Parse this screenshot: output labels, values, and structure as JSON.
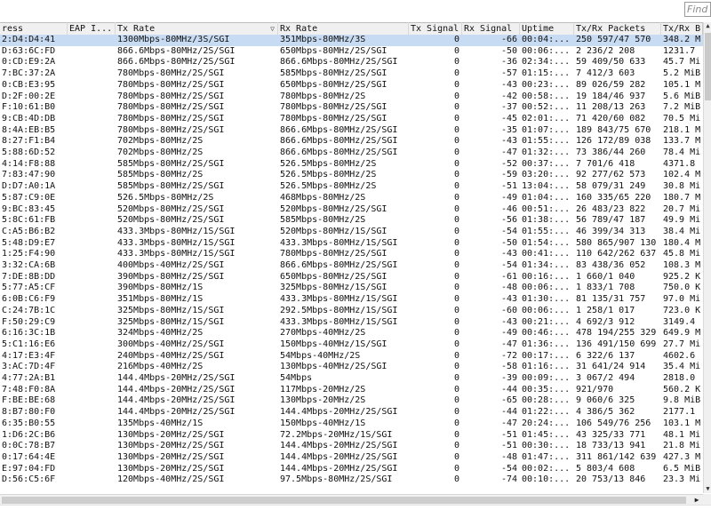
{
  "search": {
    "placeholder": "Find"
  },
  "columns": [
    {
      "key": "mac",
      "label": "ress"
    },
    {
      "key": "eap",
      "label": "EAP I..."
    },
    {
      "key": "tx_rate",
      "label": "Tx Rate"
    },
    {
      "key": "rx_rate",
      "label": "Rx Rate"
    },
    {
      "key": "tx_signal",
      "label": "Tx Signal"
    },
    {
      "key": "rx_signal",
      "label": "Rx Signal"
    },
    {
      "key": "uptime",
      "label": "Uptime"
    },
    {
      "key": "packets",
      "label": "Tx/Rx Packets"
    },
    {
      "key": "bytes",
      "label": "Tx/Rx B"
    }
  ],
  "sorted_column_mark": "▽",
  "selected_row": 0,
  "rows": [
    [
      "2:D4:D4:41",
      "",
      "1300Mbps-80MHz/3S/SGI",
      "351Mbps-80MHz/3S",
      "0",
      "-66",
      "00:04:...",
      "250 597/47 570",
      "348.2 M"
    ],
    [
      "D:63:6C:FD",
      "",
      "866.6Mbps-80MHz/2S/SGI",
      "650Mbps-80MHz/2S/SGI",
      "0",
      "-50",
      "00:06:...",
      "2 236/2 208",
      "1231.7"
    ],
    [
      "0:CD:E9:2A",
      "",
      "866.6Mbps-80MHz/2S/SGI",
      "866.6Mbps-80MHz/2S/SGI",
      "0",
      "-36",
      "02:34:...",
      "59 409/50 633",
      "45.7 Mi"
    ],
    [
      "7:BC:37:2A",
      "",
      "780Mbps-80MHz/2S/SGI",
      "585Mbps-80MHz/2S/SGI",
      "0",
      "-57",
      "01:15:...",
      "7 412/3 603",
      "5.2 MiB"
    ],
    [
      "0:CB:E3:95",
      "",
      "780Mbps-80MHz/2S/SGI",
      "650Mbps-80MHz/2S/SGI",
      "0",
      "-43",
      "00:23:...",
      "89 026/59 282",
      "105.1 M"
    ],
    [
      "D:2F:00:2E",
      "",
      "780Mbps-80MHz/2S/SGI",
      "780Mbps-80MHz/2S",
      "0",
      "-42",
      "00:58:...",
      "19 184/46 937",
      "5.6 MiB"
    ],
    [
      "F:10:61:B0",
      "",
      "780Mbps-80MHz/2S/SGI",
      "780Mbps-80MHz/2S/SGI",
      "0",
      "-37",
      "00:52:...",
      "11 208/13 263",
      "7.2 MiB"
    ],
    [
      "9:CB:4D:DB",
      "",
      "780Mbps-80MHz/2S/SGI",
      "780Mbps-80MHz/2S/SGI",
      "0",
      "-45",
      "02:01:...",
      "71 420/60 082",
      "70.5 Mi"
    ],
    [
      "8:4A:EB:B5",
      "",
      "780Mbps-80MHz/2S/SGI",
      "866.6Mbps-80MHz/2S/SGI",
      "0",
      "-35",
      "01:07:...",
      "189 843/75 670",
      "218.1 M"
    ],
    [
      "8:27:F1:B4",
      "",
      "702Mbps-80MHz/2S",
      "866.6Mbps-80MHz/2S/SGI",
      "0",
      "-43",
      "01:55:...",
      "126 172/89 038",
      "133.7 M"
    ],
    [
      "5:88:6D:52",
      "",
      "702Mbps-80MHz/2S",
      "866.6Mbps-80MHz/2S/SGI",
      "0",
      "-47",
      "01:32:...",
      "73 386/44 260",
      "78.4 Mi"
    ],
    [
      "4:14:F8:88",
      "",
      "585Mbps-80MHz/2S/SGI",
      "526.5Mbps-80MHz/2S",
      "0",
      "-52",
      "00:37:...",
      "7 701/6 418",
      "4371.8"
    ],
    [
      "7:83:47:90",
      "",
      "585Mbps-80MHz/2S",
      "526.5Mbps-80MHz/2S",
      "0",
      "-59",
      "03:20:...",
      "92 277/62 573",
      "102.4 M"
    ],
    [
      "D:D7:A0:1A",
      "",
      "585Mbps-80MHz/2S/SGI",
      "526.5Mbps-80MHz/2S",
      "0",
      "-51",
      "13:04:...",
      "58 079/31 249",
      "30.8 Mi"
    ],
    [
      "5:87:C9:0E",
      "",
      "526.5Mbps-80MHz/2S",
      "468Mbps-80MHz/2S",
      "0",
      "-49",
      "01:04:...",
      "160 335/65 220",
      "180.7 M"
    ],
    [
      "9:BC:83:45",
      "",
      "520Mbps-80MHz/2S/SGI",
      "520Mbps-80MHz/2S/SGI",
      "0",
      "-46",
      "00:51:...",
      "26 483/23 822",
      "20.7 Mi"
    ],
    [
      "5:8C:61:FB",
      "",
      "520Mbps-80MHz/2S/SGI",
      "585Mbps-80MHz/2S",
      "0",
      "-56",
      "01:38:...",
      "56 789/47 187",
      "49.9 Mi"
    ],
    [
      "C:A5:B6:B2",
      "",
      "433.3Mbps-80MHz/1S/SGI",
      "520Mbps-80MHz/1S/SGI",
      "0",
      "-54",
      "01:55:...",
      "46 399/34 313",
      "38.4 Mi"
    ],
    [
      "5:48:D9:E7",
      "",
      "433.3Mbps-80MHz/1S/SGI",
      "433.3Mbps-80MHz/1S/SGI",
      "0",
      "-50",
      "01:54:...",
      "580 865/907 130",
      "180.4 M"
    ],
    [
      "1:25:F4:90",
      "",
      "433.3Mbps-80MHz/1S/SGI",
      "780Mbps-80MHz/2S/SGI",
      "0",
      "-43",
      "00:41:...",
      "110 642/262 637",
      "45.8 Mi"
    ],
    [
      "3:32:CA:6B",
      "",
      "400Mbps-40MHz/2S/SGI",
      "866.6Mbps-80MHz/2S/SGI",
      "0",
      "-54",
      "01:34:...",
      "83 438/36 052",
      "108.3 M"
    ],
    [
      "7:DE:8B:DD",
      "",
      "390Mbps-80MHz/2S/SGI",
      "650Mbps-80MHz/2S/SGI",
      "0",
      "-61",
      "00:16:...",
      "1 660/1 040",
      "925.2 K"
    ],
    [
      "5:77:A5:CF",
      "",
      "390Mbps-80MHz/1S",
      "325Mbps-80MHz/1S/SGI",
      "0",
      "-48",
      "00:06:...",
      "1 833/1 708",
      "750.0 K"
    ],
    [
      "6:0B:C6:F9",
      "",
      "351Mbps-80MHz/1S",
      "433.3Mbps-80MHz/1S/SGI",
      "0",
      "-43",
      "01:30:...",
      "81 135/31 757",
      "97.0 Mi"
    ],
    [
      "C:24:7B:1C",
      "",
      "325Mbps-80MHz/1S/SGI",
      "292.5Mbps-80MHz/1S/SGI",
      "0",
      "-60",
      "00:06:...",
      "1 258/1 017",
      "723.0 K"
    ],
    [
      "F:50:29:C9",
      "",
      "325Mbps-80MHz/1S/SGI",
      "433.3Mbps-80MHz/1S/SGI",
      "0",
      "-43",
      "00:21:...",
      "4 692/3 912",
      "3149.4"
    ],
    [
      "6:16:3C:1B",
      "",
      "324Mbps-40MHz/2S",
      "270Mbps-40MHz/2S",
      "0",
      "-49",
      "00:46:...",
      "478 194/255 329",
      "649.9 M"
    ],
    [
      "5:C1:16:E6",
      "",
      "300Mbps-40MHz/2S/SGI",
      "150Mbps-40MHz/1S/SGI",
      "0",
      "-47",
      "01:36:...",
      "136 491/150 699",
      "27.7 Mi"
    ],
    [
      "4:17:E3:4F",
      "",
      "240Mbps-40MHz/2S/SGI",
      "54Mbps-40MHz/2S",
      "0",
      "-72",
      "00:17:...",
      "6 322/6 137",
      "4602.6"
    ],
    [
      "3:AC:7D:4F",
      "",
      "216Mbps-40MHz/2S",
      "130Mbps-40MHz/2S/SGI",
      "0",
      "-58",
      "01:16:...",
      "31 641/24 914",
      "35.4 Mi"
    ],
    [
      "4:77:2A:B1",
      "",
      "144.4Mbps-20MHz/2S/SGI",
      "54Mbps",
      "0",
      "-39",
      "00:09:...",
      "3 067/2 494",
      "2818.0"
    ],
    [
      "7:48:F0:8A",
      "",
      "144.4Mbps-20MHz/2S/SGI",
      "117Mbps-20MHz/2S",
      "0",
      "-44",
      "00:35:...",
      "921/970",
      "560.2 K"
    ],
    [
      "F:BE:BE:68",
      "",
      "144.4Mbps-20MHz/2S/SGI",
      "130Mbps-20MHz/2S",
      "0",
      "-65",
      "00:28:...",
      "9 060/6 325",
      "9.8 MiB"
    ],
    [
      "8:B7:80:F0",
      "",
      "144.4Mbps-20MHz/2S/SGI",
      "144.4Mbps-20MHz/2S/SGI",
      "0",
      "-44",
      "01:22:...",
      "4 386/5 362",
      "2177.1"
    ],
    [
      "6:35:B0:55",
      "",
      "135Mbps-40MHz/1S",
      "150Mbps-40MHz/1S",
      "0",
      "-47",
      "20:24:...",
      "106 549/76 256",
      "103.1 M"
    ],
    [
      "1:D6:2C:B6",
      "",
      "130Mbps-20MHz/2S/SGI",
      "72.2Mbps-20MHz/1S/SGI",
      "0",
      "-51",
      "01:45:...",
      "43 325/33 771",
      "48.1 Mi"
    ],
    [
      "0:0C:78:B7",
      "",
      "130Mbps-20MHz/2S/SGI",
      "144.4Mbps-20MHz/2S/SGI",
      "0",
      "-51",
      "00:30:...",
      "18 733/13 941",
      "21.8 Mi"
    ],
    [
      "0:17:64:4E",
      "",
      "130Mbps-20MHz/2S/SGI",
      "144.4Mbps-20MHz/2S/SGI",
      "0",
      "-48",
      "01:47:...",
      "311 861/142 639",
      "427.3 M"
    ],
    [
      "E:97:04:FD",
      "",
      "130Mbps-20MHz/2S/SGI",
      "144.4Mbps-20MHz/2S/SGI",
      "0",
      "-54",
      "00:02:...",
      "5 803/4 608",
      "6.5 MiB"
    ],
    [
      "D:56:C5:6F",
      "",
      "120Mbps-40MHz/2S/SGI",
      "97.5Mbps-80MHz/2S/SGI",
      "0",
      "-74",
      "00:10:...",
      "20 753/13 846",
      "23.3 Mi"
    ]
  ]
}
